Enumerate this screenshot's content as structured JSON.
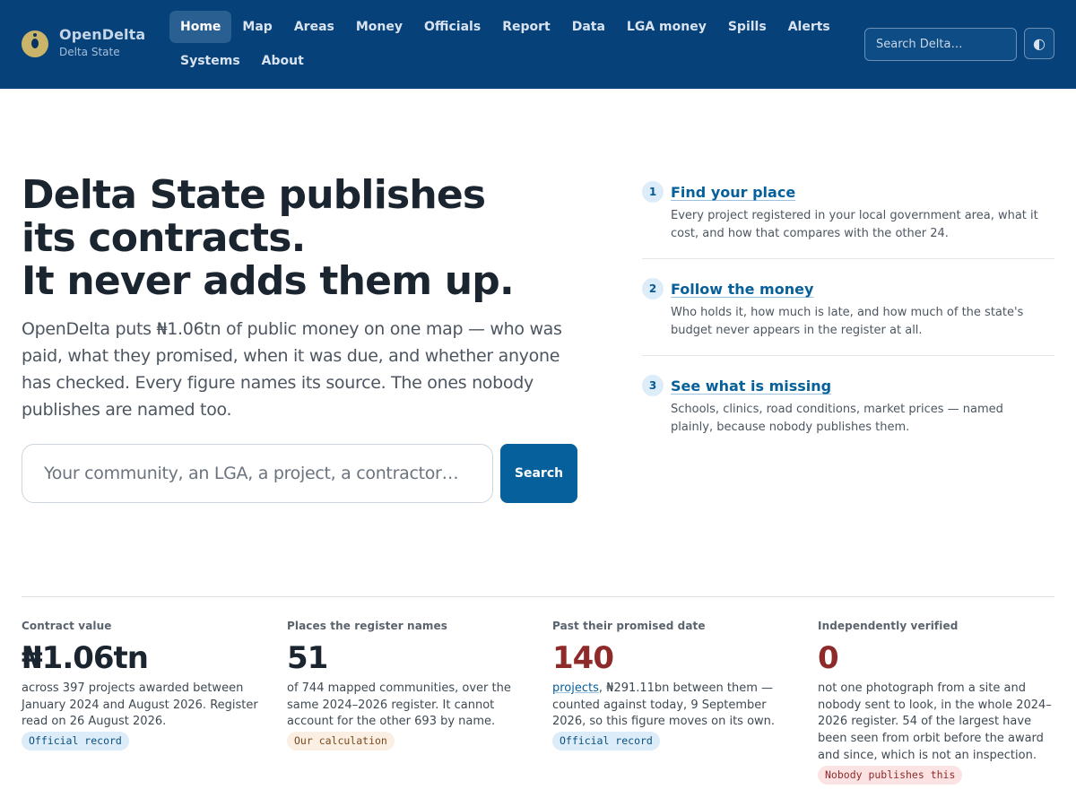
{
  "brand": {
    "name": "OpenDelta",
    "subtitle": "Delta State"
  },
  "nav": {
    "row1": [
      "Home",
      "Map",
      "Areas",
      "Money",
      "Officials",
      "Report",
      "Data",
      "LGA money",
      "Spills",
      "Alerts"
    ],
    "row2": [
      "Systems",
      "About"
    ],
    "active": "Home"
  },
  "header_search": {
    "placeholder": "Search Delta…"
  },
  "theme_toggle": {
    "glyph": "◐"
  },
  "hero": {
    "title_lines": [
      "Delta State publishes",
      "its contracts.",
      "It never adds them up."
    ],
    "description": "OpenDelta puts ₦1.06tn of public money on one map — who was paid, what they promised, when it was due, and whether anyone has checked. Every figure names its source. The ones nobody publishes are named too.",
    "search_placeholder": "Your community, an LGA, a project, a contractor…",
    "search_button": "Search"
  },
  "steps": [
    {
      "num": "1",
      "title": "Find your place",
      "desc": "Every project registered in your local government area, what it cost, and how that compares with the other 24."
    },
    {
      "num": "2",
      "title": "Follow the money",
      "desc": "Who holds it, how much is late, and how much of the state's budget never appears in the register at all."
    },
    {
      "num": "3",
      "title": "See what is missing",
      "desc": "Schools, clinics, road conditions, market prices — named plainly, because nobody publishes them."
    }
  ],
  "stats": [
    {
      "label": "Contract value",
      "value": "₦1.06tn",
      "desc": "across 397 projects awarded between January 2024 and August 2026. Register read on 26 August 2026.",
      "badge": "Official record",
      "badge_type": "official"
    },
    {
      "label": "Places the register names",
      "value": "51",
      "desc": "of 744 mapped communities, over the same 2024–2026 register. It cannot account for the other 693 by name.",
      "badge": "Our calculation",
      "badge_type": "calc"
    },
    {
      "label": "Past their promised date",
      "value": "140",
      "link": "projects",
      "desc": ", ₦291.11bn between them — counted against today, 9 September 2026, so this figure moves on its own.",
      "badge": "Official record",
      "badge_type": "official"
    },
    {
      "label": "Independently verified",
      "value": "0",
      "desc": "not one photograph from a site and nobody sent to look, in the whole 2024–2026 register. 54 of the largest have been seen from orbit before the award and since, which is not an inspection.",
      "badge": "Nobody publishes this",
      "badge_type": "none"
    }
  ],
  "colors": {
    "header_bg": "#064179",
    "accent": "#05609c",
    "alert_red": "#8f2a2a"
  }
}
